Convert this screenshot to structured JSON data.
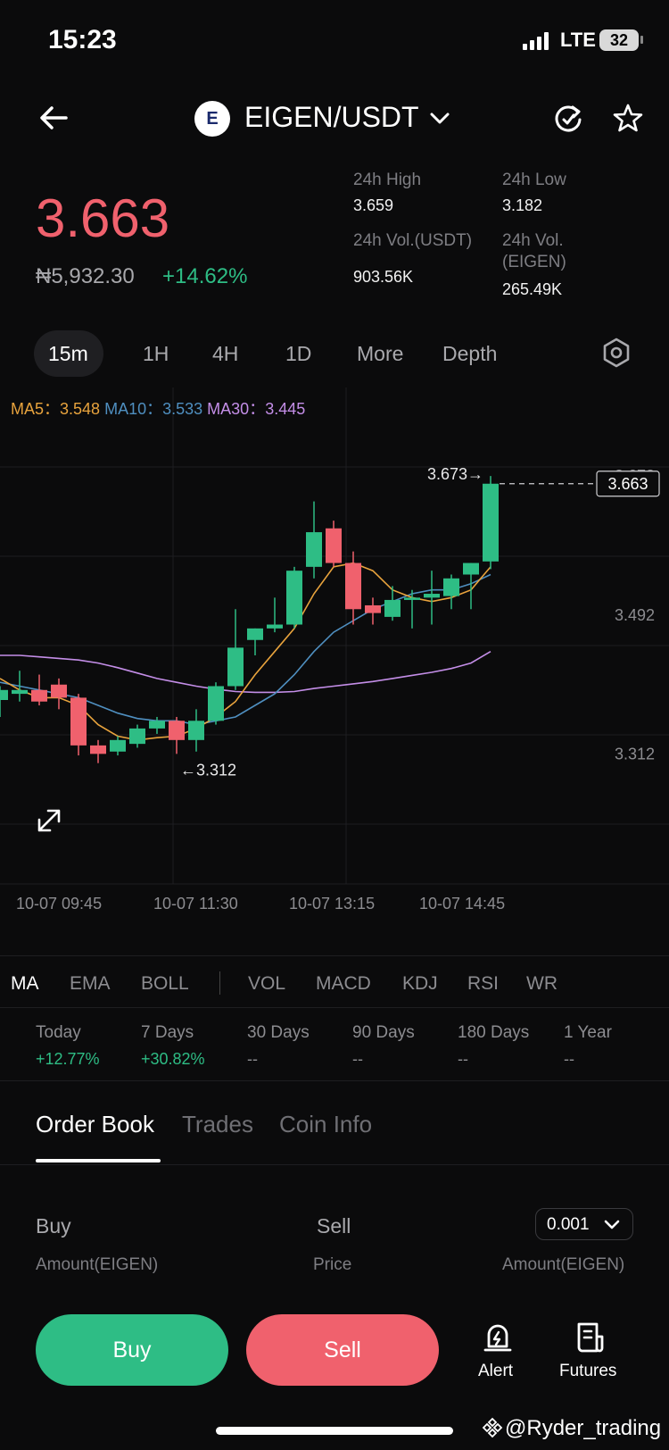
{
  "status": {
    "time": "15:23",
    "network": "LTE",
    "battery": "32"
  },
  "header": {
    "pair": "EIGEN/USDT",
    "logo_text": "E"
  },
  "price": {
    "last": "3.663",
    "fiat": "₦5,932.30",
    "change": "+14.62%"
  },
  "stats": {
    "high_label": "24h High",
    "high": "3.659",
    "low_label": "24h Low",
    "low": "3.182",
    "vol_usdt_label": "24h Vol.(USDT)",
    "vol_usdt": "903.56K",
    "vol_eigen_label1": "24h Vol.",
    "vol_eigen_label2": "(EIGEN)",
    "vol_eigen": "265.49K"
  },
  "intervals": [
    "15m",
    "1H",
    "4H",
    "1D",
    "More",
    "Depth"
  ],
  "ma_legend": {
    "ma5_label": "MA5：",
    "ma5": "3.548",
    "ma10_label": "MA10：",
    "ma10": "3.533",
    "ma30_label": "MA30：",
    "ma30": "3.445"
  },
  "colors": {
    "up": "#2ebd85",
    "down": "#f0616d",
    "ma5": "#e8a33d",
    "ma10": "#4f8fc0",
    "ma30": "#c48ee8"
  },
  "chart_data": {
    "type": "candlestick",
    "y_axis_labels": [
      "3.673",
      "3.492",
      "3.312"
    ],
    "last_price_tag": "3.663",
    "high_marker": "3.673→",
    "low_marker": "←3.312",
    "x_labels": [
      "10-07 09:45",
      "10-07 11:30",
      "10-07 13:15",
      "10-07 14:45"
    ],
    "ylim": [
      3.15,
      3.73
    ],
    "candles": [
      {
        "o": 3.382,
        "h": 3.4,
        "l": 3.36,
        "c": 3.395
      },
      {
        "o": 3.39,
        "h": 3.42,
        "l": 3.38,
        "c": 3.395
      },
      {
        "o": 3.395,
        "h": 3.415,
        "l": 3.375,
        "c": 3.38
      },
      {
        "o": 3.402,
        "h": 3.41,
        "l": 3.37,
        "c": 3.385
      },
      {
        "o": 3.385,
        "h": 3.39,
        "l": 3.31,
        "c": 3.323
      },
      {
        "o": 3.323,
        "h": 3.33,
        "l": 3.3,
        "c": 3.312
      },
      {
        "o": 3.315,
        "h": 3.335,
        "l": 3.31,
        "c": 3.33
      },
      {
        "o": 3.325,
        "h": 3.35,
        "l": 3.32,
        "c": 3.345
      },
      {
        "o": 3.345,
        "h": 3.36,
        "l": 3.338,
        "c": 3.355
      },
      {
        "o": 3.355,
        "h": 3.36,
        "l": 3.312,
        "c": 3.33
      },
      {
        "o": 3.33,
        "h": 3.37,
        "l": 3.315,
        "c": 3.355
      },
      {
        "o": 3.355,
        "h": 3.405,
        "l": 3.35,
        "c": 3.4
      },
      {
        "o": 3.4,
        "h": 3.5,
        "l": 3.395,
        "c": 3.45
      },
      {
        "o": 3.46,
        "h": 3.475,
        "l": 3.44,
        "c": 3.475
      },
      {
        "o": 3.475,
        "h": 3.515,
        "l": 3.47,
        "c": 3.48
      },
      {
        "o": 3.48,
        "h": 3.555,
        "l": 3.475,
        "c": 3.55
      },
      {
        "o": 3.555,
        "h": 3.64,
        "l": 3.54,
        "c": 3.6
      },
      {
        "o": 3.605,
        "h": 3.615,
        "l": 3.555,
        "c": 3.56
      },
      {
        "o": 3.56,
        "h": 3.575,
        "l": 3.48,
        "c": 3.5
      },
      {
        "o": 3.505,
        "h": 3.515,
        "l": 3.48,
        "c": 3.495
      },
      {
        "o": 3.49,
        "h": 3.53,
        "l": 3.485,
        "c": 3.512
      },
      {
        "o": 3.512,
        "h": 3.525,
        "l": 3.475,
        "c": 3.515
      },
      {
        "o": 3.515,
        "h": 3.55,
        "l": 3.48,
        "c": 3.52
      },
      {
        "o": 3.517,
        "h": 3.545,
        "l": 3.5,
        "c": 3.54
      },
      {
        "o": 3.545,
        "h": 3.56,
        "l": 3.5,
        "c": 3.56
      },
      {
        "o": 3.562,
        "h": 3.673,
        "l": 3.552,
        "c": 3.663
      }
    ],
    "ma5": [
      3.41,
      3.395,
      3.385,
      3.385,
      3.375,
      3.35,
      3.335,
      3.33,
      3.333,
      3.335,
      3.345,
      3.36,
      3.38,
      3.415,
      3.445,
      3.475,
      3.52,
      3.555,
      3.56,
      3.55,
      3.525,
      3.515,
      3.51,
      3.515,
      3.525,
      3.555
    ],
    "ma10": [
      3.405,
      3.4,
      3.395,
      3.39,
      3.385,
      3.375,
      3.365,
      3.358,
      3.355,
      3.355,
      3.35,
      3.355,
      3.36,
      3.375,
      3.39,
      3.415,
      3.445,
      3.47,
      3.485,
      3.5,
      3.51,
      3.52,
      3.525,
      3.525,
      3.533,
      3.545
    ],
    "ma30": [
      3.44,
      3.44,
      3.438,
      3.436,
      3.434,
      3.43,
      3.424,
      3.417,
      3.41,
      3.405,
      3.4,
      3.396,
      3.393,
      3.392,
      3.392,
      3.393,
      3.397,
      3.4,
      3.403,
      3.406,
      3.41,
      3.414,
      3.418,
      3.423,
      3.43,
      3.445
    ]
  },
  "indicators": [
    "MA",
    "EMA",
    "BOLL",
    "VOL",
    "MACD",
    "KDJ",
    "RSI",
    "WR"
  ],
  "periods": [
    {
      "label": "Today",
      "value": "+12.77%"
    },
    {
      "label": "7 Days",
      "value": "+30.82%"
    },
    {
      "label": "30 Days",
      "value": "--"
    },
    {
      "label": "90 Days",
      "value": "--"
    },
    {
      "label": "180 Days",
      "value": "--"
    },
    {
      "label": "1 Year",
      "value": "--"
    }
  ],
  "sections": [
    "Order Book",
    "Trades",
    "Coin Info"
  ],
  "orderbook": {
    "buy": "Buy",
    "sell": "Sell",
    "precision": "0.001",
    "amount_left": "Amount(EIGEN)",
    "price": "Price",
    "amount_right": "Amount(EIGEN)"
  },
  "bottom": {
    "buy": "Buy",
    "sell": "Sell",
    "alert": "Alert",
    "futures": "Futures"
  },
  "watermark": "@Ryder_trading"
}
